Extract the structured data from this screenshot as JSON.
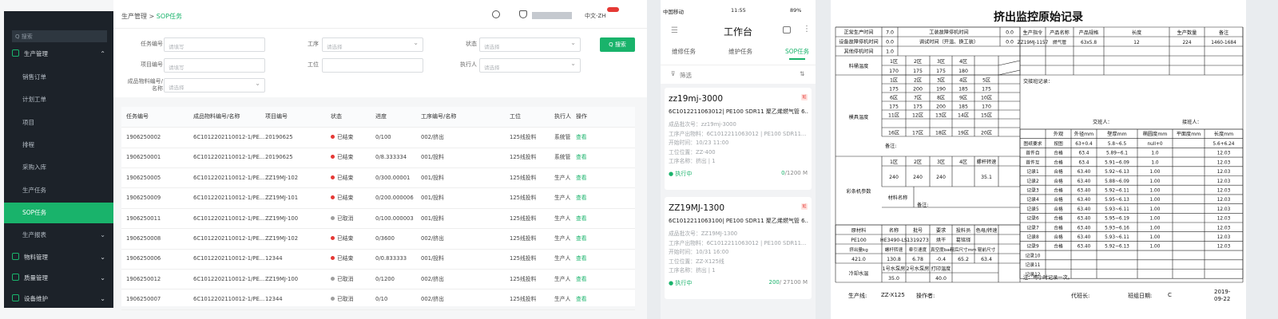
{
  "web": {
    "sidebar": {
      "search_placeholder": "Q 搜索",
      "group": "生产管理",
      "items": [
        "销售订单",
        "计划工单",
        "项目",
        "排程",
        "采购入库",
        "生产任务",
        "SOP任务",
        "生产报表"
      ],
      "selected_index": 6,
      "bottom_groups": [
        "物料管理",
        "质量管理",
        "设备维护"
      ]
    },
    "header": {
      "breadcrumb_root": "生产管理",
      "breadcrumb_sep": ">",
      "breadcrumb_current": "SOP任务",
      "language": "中文-ZH"
    },
    "filters": {
      "task_no": {
        "label": "任务编号",
        "placeholder": "请填写"
      },
      "process": {
        "label": "工序",
        "placeholder": "请选择"
      },
      "status": {
        "label": "状态",
        "placeholder": "请选择"
      },
      "project_no": {
        "label": "项目编号",
        "placeholder": "请填写"
      },
      "station": {
        "label": "工位",
        "placeholder": ""
      },
      "executor": {
        "label": "执行人",
        "placeholder": "请选择"
      },
      "material": {
        "label_line1": "成品物料编号/",
        "label_line2": "名称",
        "placeholder": "请选择"
      },
      "search_button": "Q 搜索"
    },
    "table": {
      "columns": [
        "任务编号",
        "成品物料编号/名称",
        "项目编号",
        "状态",
        "进度",
        "工序编号/名称",
        "工位",
        "执行人",
        "操作"
      ],
      "rows": [
        [
          "1906250002",
          "6C1012202110012-1/PE...",
          "20190625",
          "已结束",
          "0/100",
          "002/挤出",
          "125线投料",
          "系统管",
          "查看"
        ],
        [
          "1906250001",
          "6C1012202110012-1/PE...",
          "20190625",
          "已结束",
          "0/8.333334",
          "001/投料",
          "125线投料",
          "系统管",
          "查看"
        ],
        [
          "1906250005",
          "6C1012202110012-1/PE...",
          "ZZ19MJ-102",
          "已结束",
          "0/300.00001",
          "001/投料",
          "125线投料",
          "生产人",
          "查看"
        ],
        [
          "1906250009",
          "6C1012202110012-1/PE...",
          "ZZ19MJ-101",
          "已结束",
          "0/200.000006",
          "001/投料",
          "125线投料",
          "生产人",
          "查看"
        ],
        [
          "1906250011",
          "6C1012202110012-1/PE...",
          "ZZ19MJ-100",
          "已取消",
          "0/100.000003",
          "001/投料",
          "125线投料",
          "生产人",
          "查看"
        ],
        [
          "1906250008",
          "6C1012202110012-1/PE...",
          "ZZ19MJ-102",
          "已结束",
          "0/3600",
          "002/挤出",
          "125线投料",
          "生产人",
          "查看"
        ],
        [
          "1906250006",
          "6C1012202110012-1/PE...",
          "12344",
          "已结束",
          "0/0.833333",
          "001/投料",
          "125线投料",
          "生产人",
          "查看"
        ],
        [
          "1906250012",
          "6C1012202110012-1/PE...",
          "ZZ19MJ-100",
          "已取消",
          "0/1200",
          "002/挤出",
          "125线投料",
          "生产人",
          "查看"
        ],
        [
          "1906250007",
          "6C1012202110012-1/PE...",
          "12344",
          "已取消",
          "0/10",
          "002/挤出",
          "125线投料",
          "生产人",
          "查看"
        ]
      ]
    },
    "colors": {
      "accent": "#19b36b",
      "ended": "#e53935",
      "cancelled": "#9e9e9e",
      "sidebar": "#1c2229"
    }
  },
  "mobile": {
    "status_bar": {
      "carrier": "中国移动",
      "time": "11:55",
      "battery": "89%"
    },
    "title": "工作台",
    "tabs": [
      "维修任务",
      "维护任务",
      "SOP任务"
    ],
    "active_tab": 2,
    "filter_label": "筛选",
    "cards": [
      {
        "title": "zz19mj-3000",
        "tag": "延",
        "subtitle": "6C1012211063012| PE100 SDR11 聚乙烯燃气管 6...",
        "lines": [
          "成品批次号：zz19mj-3000",
          "工序产出物料：6C1012211063012 | PE100 SDR11...",
          "开始时间：10/23 11:00",
          "工位位置：ZZ-400",
          "工序名称：挤出 | 1"
        ],
        "status": "执行中",
        "done": "0",
        "total": "/1200 M"
      },
      {
        "title": "ZZ19MJ-1300",
        "tag": "延",
        "subtitle": "6C1012211063100| PE100 SDR11 聚乙烯燃气管 6...",
        "lines": [
          "成品批次号：ZZ19MJ-1300",
          "工序产出物料：6C1012211063012 | PE100 SDR11...",
          "开始时间：10/31 16:00",
          "工位位置：ZZ-X125线",
          "工序名称：挤出 | 1"
        ],
        "status": "执行中",
        "done": "200",
        "total": "/ 27100 M"
      }
    ]
  },
  "document": {
    "title": "挤出监控原始记录",
    "downtime": [
      {
        "label": "正常生产时间",
        "value": "7.0",
        "label2": "工装故障停机时间",
        "value2": "0.0"
      },
      {
        "label": "设备故障停机时间",
        "value": "0.0",
        "label2": "调试时间（开温、换工装）",
        "value2": "0.0"
      },
      {
        "label": "其他停机时间",
        "value": "1.0"
      }
    ],
    "product": {
      "headers": [
        "生产指令",
        "产品名称",
        "产品规格",
        "长度",
        "生产数量",
        "备注"
      ],
      "values": [
        "ZZ19MJ-1157",
        "燃气管",
        "63x5.8",
        "12",
        "224",
        "1460-1684"
      ]
    },
    "material_temp": {
      "label": "料桶温度",
      "zones": [
        "1区",
        "2区",
        "3区",
        "4区"
      ],
      "values": [
        "170",
        "175",
        "175",
        "180"
      ]
    },
    "mold_temp": {
      "label": "模具温度",
      "rows": [
        [
          "1区",
          "2区",
          "3区",
          "4区",
          "5区"
        ],
        [
          "175",
          "200",
          "190",
          "185",
          "175"
        ],
        [
          "6区",
          "7区",
          "8区",
          "9区",
          "10区"
        ],
        [
          "175",
          "175",
          "200",
          "185",
          "170"
        ],
        [
          "11区",
          "12区",
          "13区",
          "14区",
          "15区"
        ],
        [
          "",
          "",
          "",
          "",
          ""
        ],
        [
          "16区",
          "17区",
          "18区",
          "19区",
          "20区"
        ]
      ],
      "remark_label": "备注:"
    },
    "stripe": {
      "label": "彩条机参数",
      "zones": [
        "1区",
        "2区",
        "3区",
        "4区",
        "螺杆转速"
      ],
      "values": [
        "240",
        "240",
        "240",
        "",
        "35.1"
      ],
      "material_name_label": "材料名称",
      "remark_label": "备注:"
    },
    "raw": {
      "headers": [
        "原材料",
        "名称",
        "批号",
        "要求",
        "投料员",
        "色母/转速"
      ],
      "values": [
        "PE100",
        "HE3490-LS",
        "1319273",
        "烘干",
        "葛铭铎",
        ""
      ]
    },
    "extrude": {
      "headers": [
        "挤出量kg",
        "螺杆转速",
        "牵引速度",
        "真空度bar",
        "辊后尺寸mm",
        "辊前尺寸"
      ],
      "values": [
        "421.0",
        "130.8",
        "6.78",
        "-0.4",
        "65.2",
        "63.4"
      ]
    },
    "cooling": {
      "label": "冷却水温",
      "headers": [
        "1号水泵房",
        "2号水泵房",
        "打印温度"
      ],
      "values": [
        "35.0",
        "",
        "40.0"
      ]
    },
    "shift": {
      "handover_label": "交接班记录：",
      "from_label": "交班人：",
      "to_label": "接班人："
    },
    "measure": {
      "headers": [
        "",
        "外观",
        "外径mm",
        "壁厚mm",
        "椭圆度mm",
        "平面度mm",
        "长度mm"
      ],
      "rows": [
        [
          "图纸要求",
          "按图",
          "63+0.4",
          "5.8~6.5",
          "null+0",
          "",
          "5.6+6.24"
        ],
        [
          "首件自",
          "合格",
          "63.4",
          "5.89~6.1",
          "1.0",
          "",
          "12.03"
        ],
        [
          "首件互",
          "合格",
          "63.4",
          "5.91~6.09",
          "1.0",
          "",
          "12.03"
        ],
        [
          "记录1",
          "合格",
          "63.40",
          "5.92~6.13",
          "1.00",
          "",
          "12.03"
        ],
        [
          "记录2",
          "合格",
          "63.40",
          "5.88~6.09",
          "1.00",
          "",
          "12.03"
        ],
        [
          "记录3",
          "合格",
          "63.40",
          "5.92~6.11",
          "1.00",
          "",
          "12.03"
        ],
        [
          "记录4",
          "合格",
          "63.40",
          "5.95~6.13",
          "1.00",
          "",
          "12.03"
        ],
        [
          "记录5",
          "合格",
          "63.40",
          "5.93~6.11",
          "1.00",
          "",
          "12.03"
        ],
        [
          "记录6",
          "合格",
          "63.40",
          "5.95~6.19",
          "1.00",
          "",
          "12.03"
        ],
        [
          "记录7",
          "合格",
          "63.40",
          "5.93~6.16",
          "1.00",
          "",
          "12.03"
        ],
        [
          "记录8",
          "合格",
          "63.40",
          "5.93~6.11",
          "1.00",
          "",
          "12.03"
        ],
        [
          "记录9",
          "合格",
          "63.40",
          "5.92~6.13",
          "1.00",
          "",
          "12.03"
        ],
        [
          "记录10",
          "",
          "",
          "",
          "",
          "",
          ""
        ],
        [
          "记录11",
          "",
          "",
          "",
          "",
          "",
          ""
        ],
        [
          "记录12",
          "",
          "",
          "",
          "",
          "",
          ""
        ]
      ],
      "note": "注：每小时记录一次。"
    },
    "footer": {
      "line_label": "生产线:",
      "line_value": "ZZ-X125",
      "operator_label": "操作者:",
      "sign_label": "代班长:",
      "date_label": "班组日期:",
      "shift_value": "C",
      "date_value": "2019-09-22"
    }
  }
}
